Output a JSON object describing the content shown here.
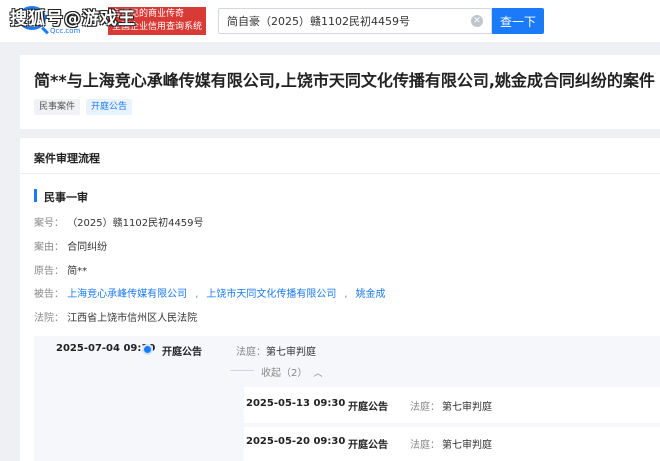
{
  "watermark": "搜狐号@游戏王",
  "header": {
    "logo_text": "Qcc.com",
    "slogan_lines": [
      "有远见的商业传奇",
      "全国企业信用查询系统"
    ],
    "search_value": "简自豪（2025）赣1102民初4459号",
    "search_button": "查一下"
  },
  "case": {
    "title": "简**与上海竞心承峰传媒有限公司,上饶市天同文化传播有限公司,姚金成合同纠纷的案件",
    "tags": [
      "民事案件",
      "开庭公告"
    ]
  },
  "process": {
    "header": "案件审理流程",
    "stage": "民事一审",
    "fields": {
      "case_no_label": "案号：",
      "case_no": "（2025）赣1102民初4459号",
      "cause_label": "案由：",
      "cause": "合同纠纷",
      "plaintiff_label": "原告：",
      "plaintiff": "简**",
      "defendant_label": "被告：",
      "defendants": [
        "上海竞心承峰传媒有限公司",
        "上饶市天同文化传播有限公司",
        "姚金成"
      ],
      "court_label": "法院：",
      "court": "江西省上饶市信州区人民法院"
    },
    "timeline": {
      "main": {
        "date": "2025-07-04 09:30",
        "event": "开庭公告",
        "court_label": "法庭：",
        "court_room": "第七审判庭"
      },
      "collapse_label": "收起（2）",
      "sub_items": [
        {
          "date": "2025-05-13 09:30",
          "event": "开庭公告",
          "court_label": "法庭：",
          "court_room": "第七审判庭"
        },
        {
          "date": "2025-05-20 09:30",
          "event": "开庭公告",
          "court_label": "法庭：",
          "court_room": "第七审判庭"
        }
      ]
    }
  },
  "colors": {
    "accent": "#1a7af8",
    "slogan_bg": "#d83a36",
    "page_bg": "#eef0f4"
  }
}
